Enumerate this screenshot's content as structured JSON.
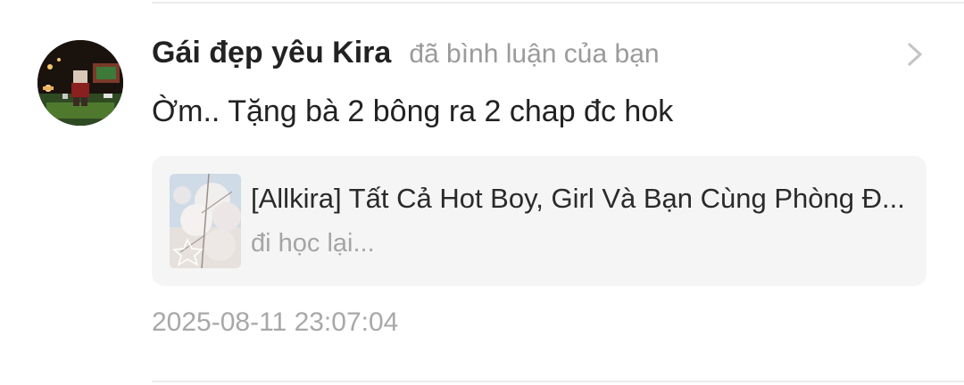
{
  "notification": {
    "username": "Gái đẹp yêu Kira",
    "action": "đã bình luận của bạn",
    "comment": "Ờm.. Tặng bà 2 bông ra 2 chap đc hok",
    "reference": {
      "title": "[Allkira] Tất Cả Hot Boy, Girl Và Bạn Cùng Phòng Đ...",
      "subtitle": "đi học lại..."
    },
    "timestamp": "2025-08-11 23:07:04",
    "icons": {
      "avatar": "user-avatar",
      "chevron": "chevron-right-icon",
      "thumbnail": "story-cover-thumbnail"
    }
  },
  "colors": {
    "username": "#222222",
    "secondary_text": "#9a9a9a",
    "card_background": "#f5f5f5",
    "divider": "#ececec"
  }
}
